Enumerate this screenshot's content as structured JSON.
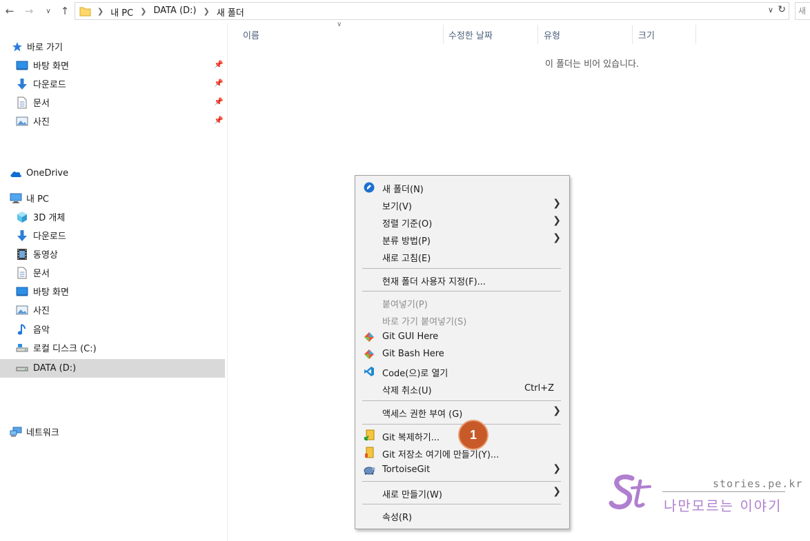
{
  "address": {
    "breadcrumbs": [
      "내 PC",
      "DATA (D:)",
      "새 폴더"
    ],
    "search_hint": "새"
  },
  "sidebar": {
    "quick_access": {
      "label": "바로 가기",
      "items": [
        {
          "label": "바탕 화면",
          "icon": "desktop-icon"
        },
        {
          "label": "다운로드",
          "icon": "download-icon"
        },
        {
          "label": "문서",
          "icon": "document-icon"
        },
        {
          "label": "사진",
          "icon": "picture-icon"
        }
      ]
    },
    "onedrive": "OneDrive",
    "this_pc": {
      "label": "내 PC",
      "items": [
        {
          "label": "3D 개체",
          "icon": "3d-objects-icon"
        },
        {
          "label": "다운로드",
          "icon": "download-icon"
        },
        {
          "label": "동영상",
          "icon": "video-icon"
        },
        {
          "label": "문서",
          "icon": "document-icon"
        },
        {
          "label": "바탕 화면",
          "icon": "desktop-icon"
        },
        {
          "label": "사진",
          "icon": "picture-icon"
        },
        {
          "label": "음악",
          "icon": "music-icon"
        },
        {
          "label": "로컬 디스크 (C:)",
          "icon": "local-disk-icon"
        },
        {
          "label": "DATA (D:)",
          "icon": "drive-icon",
          "selected": true
        }
      ]
    },
    "network": "네트워크"
  },
  "content": {
    "columns": [
      "이름",
      "수정한 날짜",
      "유형",
      "크기"
    ],
    "empty_message": "이 폴더는 비어 있습니다."
  },
  "context_menu": {
    "items": [
      {
        "label": "새 폴더(N)",
        "icon": "new-folder-icon"
      },
      {
        "label": "보기(V)",
        "submenu": true
      },
      {
        "label": "정렬 기준(O)",
        "submenu": true
      },
      {
        "label": "분류 방법(P)",
        "submenu": true
      },
      {
        "label": "새로 고침(E)"
      },
      {
        "label": "현재 폴더 사용자 지정(F)..."
      },
      {
        "label": "붙여넣기(P)",
        "disabled": true
      },
      {
        "label": "바로 가기 붙여넣기(S)",
        "disabled": true
      },
      {
        "label": "Git GUI Here",
        "icon": "git-icon"
      },
      {
        "label": "Git Bash Here",
        "icon": "git-icon"
      },
      {
        "label": "Code(으)로 열기",
        "icon": "vscode-icon"
      },
      {
        "label": "삭제 취소(U)",
        "shortcut": "Ctrl+Z"
      },
      {
        "label": "액세스 권한 부여 (G)",
        "submenu": true
      },
      {
        "label": "Git 복제하기...",
        "icon": "tortoisegit-clone-icon",
        "highlighted": true
      },
      {
        "label": "Git 저장소 여기에 만들기(Y)...",
        "icon": "tortoisegit-create-icon"
      },
      {
        "label": "TortoiseGit",
        "icon": "tortoisegit-icon",
        "submenu": true
      },
      {
        "label": "새로 만들기(W)",
        "submenu": true
      },
      {
        "label": "속성(R)"
      }
    ],
    "step_badge": "1"
  },
  "watermark": {
    "url": "stories.pe.kr",
    "text": "나만모르는 이야기"
  },
  "colors": {
    "accent_blue": "#1f6fd1",
    "highlight_yellow": "#fbf65a",
    "badge_orange": "#c85a2a",
    "watermark_purple": "#b07fd0"
  }
}
